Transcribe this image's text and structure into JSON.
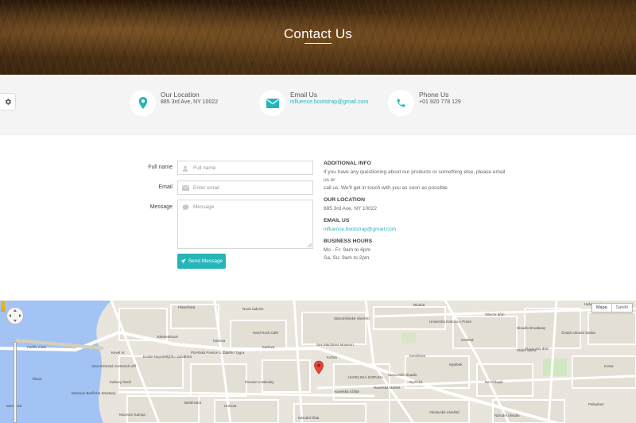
{
  "hero": {
    "title": "Contact Us"
  },
  "info": [
    {
      "label": "Our Location",
      "value": "885 3rd Ave, NY 10022",
      "icon": "location-pin-icon"
    },
    {
      "label": "Email Us",
      "value": "influence.bootstrap@gmail.com",
      "icon": "envelope-icon"
    },
    {
      "label": "Phone Us",
      "value": "+01 920 778 129",
      "icon": "phone-icon"
    }
  ],
  "form": {
    "fullname_label": "Full name",
    "fullname_placeholder": "Full name",
    "email_label": "Email",
    "email_placeholder": "Enter email",
    "message_label": "Message",
    "message_placeholder": "Message",
    "send_label": "Send Message"
  },
  "additional": {
    "heading": "ADDITIONAL INFO",
    "text_line1": "If you have any questioning about our products or something else, please email us or",
    "text_line2": "call us. We'll get in touch with you as soon as possible.",
    "location_heading": "OUR LOCATION",
    "location_value": "885 3rd Ave, NY 10022",
    "email_heading": "EMAIL US",
    "email_value": "influence.bootstrap@gmail.com",
    "hours_heading": "BUSINESS HOURS",
    "hours_line1": "Mo - Fr: 9am to 6pm",
    "hours_line2": "Sa, Su: 9am to 2pm"
  },
  "map": {
    "type_map": "Mapa",
    "type_sat": "Satelit",
    "labels": [
      "Platnéřská",
      "Nová radnice",
      "Hard Rock Café",
      "Klementinum",
      "Kostel Nejsvětějšího Salvátora",
      "Karlova",
      "Karlův most",
      "Kevel IV",
      "Staroměstská mostecká věž",
      "Karlovy lázně",
      "Museum Bedřicha Smetany",
      "Karlova",
      "Plzeňská Pivnice U Zlatého Tygra",
      "Pivovar U Bulovky",
      "Sex Machines Museum",
      "Stavovské divadlo",
      "Karolinum",
      "Národní divadlo",
      "HAVELSKÁ KORUNA",
      "Havelská tržiště",
      "Havelská Market",
      "Myslbek",
      "Státní opera",
      "Univerzita Karlova v Praze",
      "Hybernská",
      "Dlouhá",
      "Divadlo Broadway",
      "Česká národní banka",
      "Slovanský dům",
      "Palladium",
      "Obecní dům",
      "Celetná",
      "Rytířská",
      "Kožná",
      "Husova",
      "Betlémská",
      "Mostecká",
      "Vltava",
      "Národní třída",
      "Muzeum Kampa",
      "Staroměstské náměstí",
      "Na Příkopě",
      "Kotva",
      "Václavské náměstí"
    ]
  }
}
